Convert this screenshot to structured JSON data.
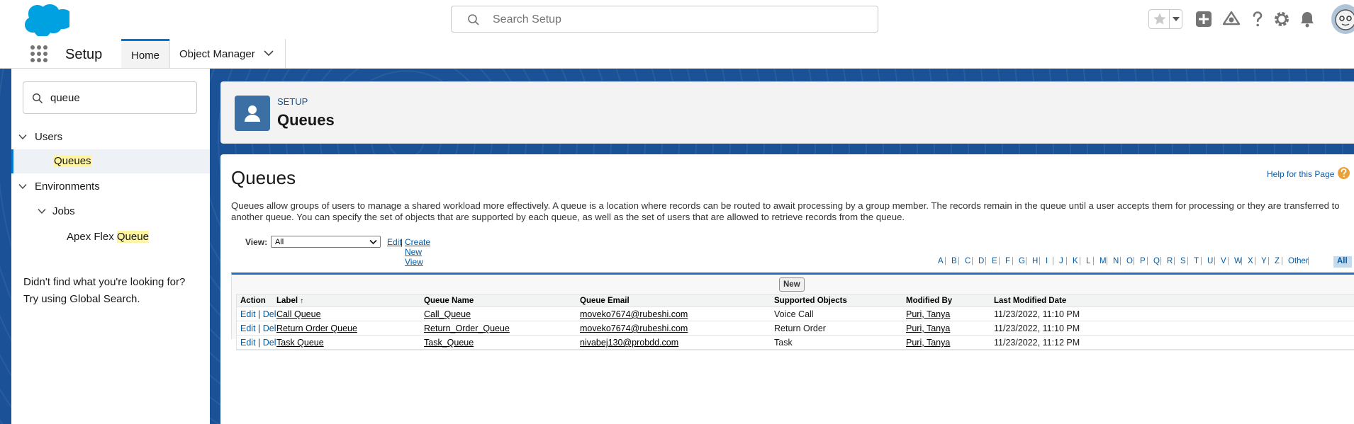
{
  "header": {
    "search_placeholder": "Search Setup",
    "icons": [
      "favorites-star-icon",
      "favorites-menu-icon",
      "global-add-icon",
      "trailhead-icon",
      "help-icon",
      "setup-gear-icon",
      "notifications-bell-icon",
      "user-avatar"
    ]
  },
  "context_bar": {
    "app_name": "Setup",
    "tabs": [
      {
        "label": "Home",
        "active": true
      },
      {
        "label": "Object Manager",
        "active": false
      }
    ]
  },
  "sidebar": {
    "quick_find_value": "queue",
    "tree": [
      {
        "label": "Users",
        "level": 0,
        "expanded": true
      },
      {
        "label_prefix": "",
        "label_highlight": "Queues",
        "level": 1,
        "selected": true
      },
      {
        "label": "Environments",
        "level": 0,
        "expanded": true
      },
      {
        "label": "Jobs",
        "level": 1,
        "expanded": true
      },
      {
        "label_prefix": "Apex Flex ",
        "label_highlight": "Queue",
        "level": 2,
        "selected": false
      }
    ],
    "help_line1": "Didn't find what you're looking for?",
    "help_line2": "Try using Global Search."
  },
  "page_header": {
    "eyebrow": "SETUP",
    "title": "Queues"
  },
  "main": {
    "title": "Queues",
    "help_link": "Help for this Page",
    "description": "Queues allow groups of users to manage a shared workload more effectively. A queue is a location where records can be routed to await processing by a group member. The records remain in the queue until a user accepts them for processing or they are transferred to another queue. You can specify the set of objects that are supported by each queue, as well as the set of users that are allowed to retrieve records from the queue.",
    "view_label": "View:",
    "view_selected": "All",
    "view_edit": "Edit",
    "view_separator": "|",
    "view_create": "Create New View",
    "alphabet": [
      "A",
      "B",
      "C",
      "D",
      "E",
      "F",
      "G",
      "H",
      "I",
      "J",
      "K",
      "L",
      "M",
      "N",
      "O",
      "P",
      "Q",
      "R",
      "S",
      "T",
      "U",
      "V",
      "W",
      "X",
      "Y",
      "Z",
      "Other",
      "All"
    ],
    "alphabet_selected": "All",
    "new_button": "New",
    "columns": [
      "Action",
      "Label",
      "Queue Name",
      "Queue Email",
      "Supported Objects",
      "Modified By",
      "Last Modified Date"
    ],
    "sort_indicator": "↑",
    "rows": [
      {
        "edit": "Edit",
        "sep": "|",
        "del": "Del",
        "label": "Call Queue",
        "queue_name": "Call_Queue",
        "email": "moveko7674@rubeshi.com",
        "objects": "Voice Call",
        "modified_by": "Puri, Tanya",
        "modified_date": "11/23/2022, 11:10 PM"
      },
      {
        "edit": "Edit",
        "sep": "|",
        "del": "Del",
        "label": "Return Order Queue",
        "queue_name": "Return_Order_Queue",
        "email": "moveko7674@rubeshi.com",
        "objects": "Return Order",
        "modified_by": "Puri, Tanya",
        "modified_date": "11/23/2022, 11:10 PM"
      },
      {
        "edit": "Edit",
        "sep": "|",
        "del": "Del",
        "label": "Task Queue",
        "queue_name": "Task_Queue",
        "email": "nivabej130@probdd.com",
        "objects": "Task",
        "modified_by": "Puri, Tanya",
        "modified_date": "11/23/2022, 11:12 PM"
      }
    ]
  },
  "colors": {
    "brand_blue": "#0176d3",
    "backdrop_blue": "#1b5297",
    "link_blue": "#015ba7",
    "highlight": "#fff5a0"
  }
}
